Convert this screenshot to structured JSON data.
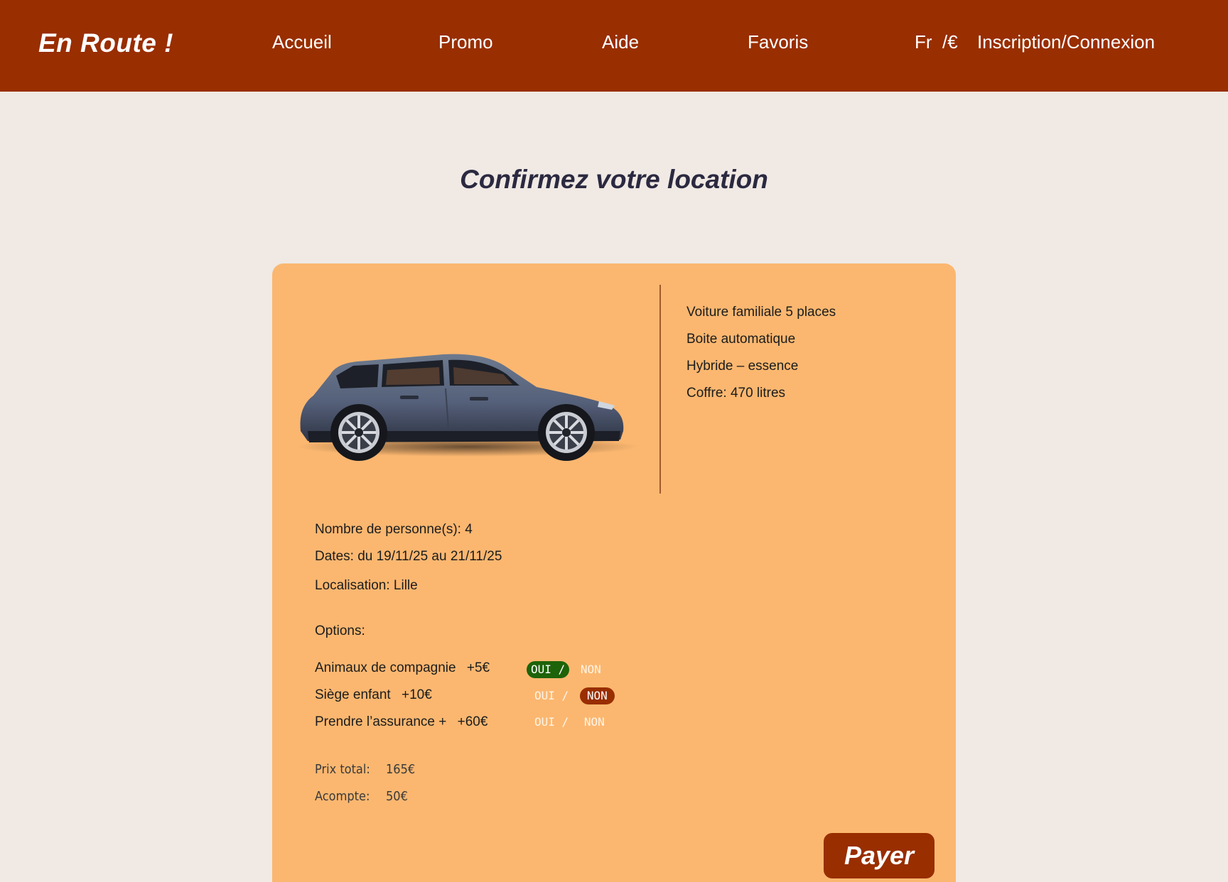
{
  "header": {
    "logo": "En Route !",
    "nav": {
      "home": "Accueil",
      "promo": "Promo",
      "help": "Aide",
      "favorites": "Favoris",
      "language": "Fr",
      "currency": "/€",
      "account": "Inscription/Connexion"
    }
  },
  "page": {
    "title": "Confirmez votre location"
  },
  "car": {
    "image": "car-suv-side-view",
    "specs": [
      "Voiture familiale 5 places",
      "Boite automatique",
      "Hybride – essence",
      "Coffre: 470 litres"
    ]
  },
  "booking": {
    "persons": "Nombre de personne(s): 4",
    "dates": "Dates: du 19/11/25 au 21/11/25",
    "location": "Localisation: Lille"
  },
  "options": {
    "heading": "Options:",
    "items": [
      {
        "label": "Animaux de compagnie",
        "price": "+5€",
        "yes": "OUI",
        "sep": "/",
        "no": "NON",
        "selected": "OUI"
      },
      {
        "label": "Siège enfant",
        "price": "+10€",
        "yes": "OUI",
        "sep": "/",
        "no": "NON",
        "selected": "NON"
      },
      {
        "label": "Prendre l’assurance +",
        "price": "+60€",
        "yes": "OUI",
        "sep": "/",
        "no": "NON",
        "selected": ""
      }
    ]
  },
  "totals": {
    "total_label": "Prix total:",
    "total_value": "165€",
    "deposit_label": "Acompte:",
    "deposit_value": "50€"
  },
  "actions": {
    "pay": "Payer"
  },
  "colors": {
    "header": "#992e00",
    "background": "#f0e9e4",
    "card": "#fbb770",
    "yes_active": "#1d6309",
    "no_active": "#992e00"
  }
}
